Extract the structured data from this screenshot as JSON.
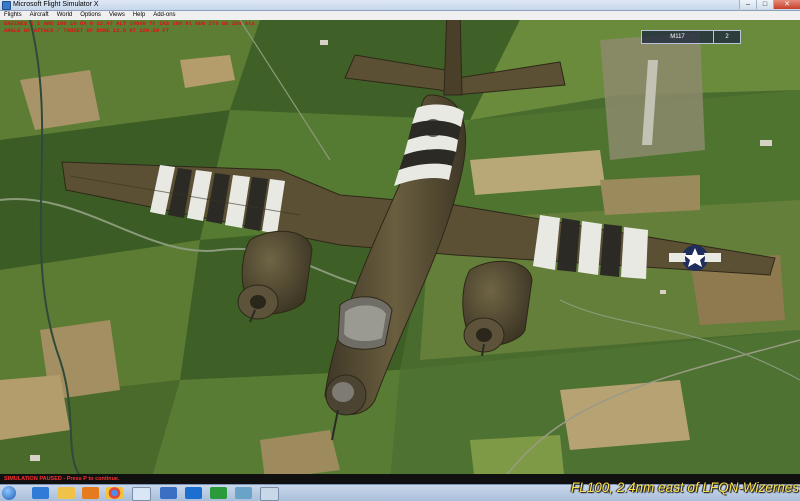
{
  "window": {
    "title": "Microsoft Flight Simulator X",
    "minimize": "–",
    "maximize": "□",
    "close": "✕"
  },
  "menu": [
    "Flights",
    "Aircraft",
    "World",
    "Options",
    "Views",
    "Help",
    "Add-ons"
  ],
  "hud": {
    "line1": "ENGINES 1 1 ARO 100 10 OA 0 12.47 ALT 10000 ft IAS 180 kt HDG 279 GS 200 kts",
    "line2": "ANGLE OF ATTACK / TARGET OF DUNE 12.0 KT 220.20 FT"
  },
  "multiplayer": {
    "callsign": "M117",
    "count": "2"
  },
  "status": {
    "text": "SIMULATION PAUSED - Press P to continue."
  },
  "caption": {
    "text": "FL100, 2.4nm east of LFQN-Wizernes"
  },
  "taskbar": {
    "icons": [
      "start-orb-icon",
      "ie-icon",
      "folder-icon",
      "media-player-icon",
      "chrome-icon",
      "document-icon",
      "firefox-icon",
      "edge-icon",
      "flight-sim-icon",
      "game-icon",
      "network-icon",
      "window-icon"
    ]
  },
  "colors": {
    "hud_text": "#e01010",
    "caption_text": "#ffe14a",
    "aircraft_olive": "#5b5034",
    "invasion_stripe_white": "#e9e9e4"
  }
}
